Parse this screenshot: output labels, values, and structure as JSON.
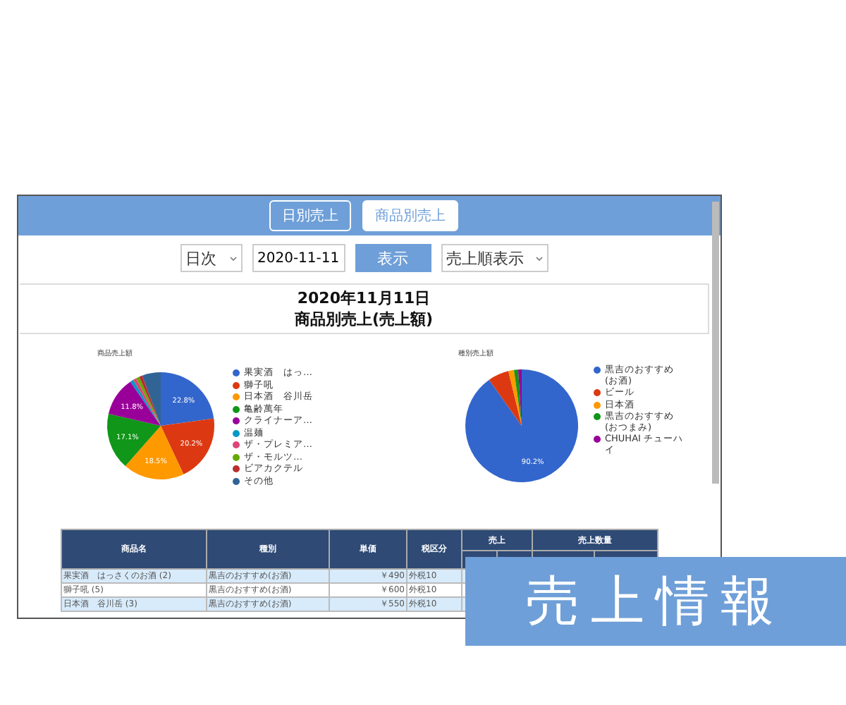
{
  "header_tabs": [
    {
      "label": "日別売上",
      "selected": false
    },
    {
      "label": "商品別売上",
      "selected": true
    }
  ],
  "controls": {
    "period": "日次",
    "date": "2020-11-11",
    "show_button": "表示",
    "sort": "売上順表示"
  },
  "report": {
    "date": "2020年11月11日",
    "title": "商品別売上(売上額)"
  },
  "charts": [
    {
      "chart_data": {
        "type": "pie",
        "title": "商品売上額",
        "categories": [
          "果実酒　はっ…",
          "獅子吼",
          "日本酒　谷川岳",
          "亀齢萬年",
          "クライナーア…",
          "温麺",
          "ザ・プレミア…",
          "ザ・モルツ…",
          "ビアカクテル",
          "その他"
        ],
        "values": [
          22.8,
          20.2,
          18.5,
          17.1,
          11.8,
          1.0,
          1.0,
          1.0,
          1.0,
          5.6
        ],
        "value_labels": [
          "22.8%",
          "20.2%",
          "18.5%",
          "17.1%",
          "11.8%",
          null,
          null,
          null,
          null,
          null
        ],
        "legend": "right"
      }
    },
    {
      "chart_data": {
        "type": "pie",
        "title": "種別売上額",
        "categories": [
          "黒吉のおすすめ(お酒)",
          "ビール",
          "日本酒",
          "黒吉のおすすめ(おつまみ)",
          "CHUHAI チューハイ"
        ],
        "values": [
          90.2,
          6.0,
          1.6,
          1.2,
          1.0
        ],
        "value_labels": [
          "90.2%",
          null,
          null,
          null,
          null
        ],
        "legend": "right"
      }
    }
  ],
  "table": {
    "columns": [
      "商品名",
      "種別",
      "単価",
      "税区分",
      "売上",
      "売上数量"
    ],
    "rows": [
      [
        "果実酒　はっさくのお酒 (2)",
        "黒吉のおすすめ(お酒)",
        "￥490",
        "外税10"
      ],
      [
        "獅子吼 (5)",
        "黒吉のおすすめ(お酒)",
        "￥600",
        "外税10"
      ],
      [
        "日本酒　谷川岳 (3)",
        "黒吉のおすすめ(お酒)",
        "￥550",
        "外税10"
      ]
    ]
  },
  "overlay_label": "売上情報"
}
